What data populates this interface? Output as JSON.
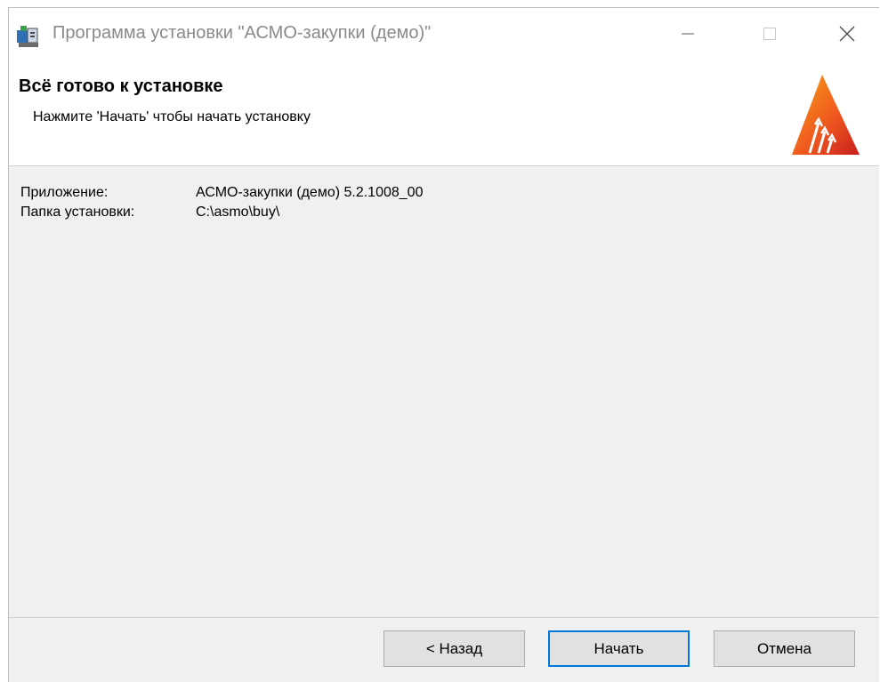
{
  "window": {
    "title": "Программа установки \"АСМО-закупки (демо)\""
  },
  "header": {
    "title": "Всё готово к установке",
    "subtitle": "Нажмите 'Начать' чтобы начать установку"
  },
  "info": {
    "app_label": "Приложение:",
    "app_value": "АСМО-закупки (демо) 5.2.1008_00",
    "folder_label": "Папка установки:",
    "folder_value": "C:\\asmo\\buy\\"
  },
  "buttons": {
    "back": "< Назад",
    "start": "Начать",
    "cancel": "Отмена"
  },
  "icons": {
    "app": "installer-icon",
    "logo": "asmo-logo",
    "minimize": "minimize-icon",
    "maximize": "maximize-icon",
    "close": "close-icon"
  },
  "colors": {
    "accent": "#0078d7",
    "logo_orange": "#f05a1e",
    "logo_yellow": "#f7a21b",
    "logo_red": "#c81e1e"
  }
}
